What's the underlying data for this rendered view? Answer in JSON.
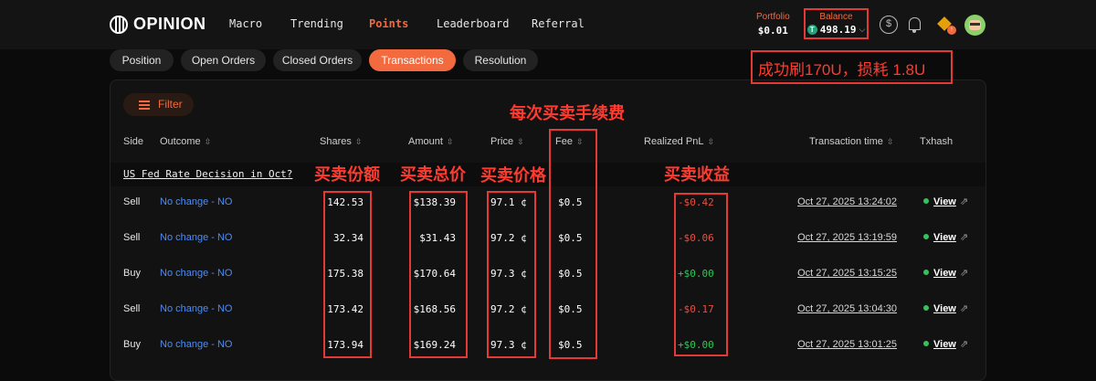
{
  "brand": "OPINION",
  "nav": [
    "Macro",
    "Trending",
    "Points",
    "Leaderboard",
    "Referral"
  ],
  "nav_active": "Points",
  "portfolio": {
    "label": "Portfolio",
    "value": "$0.01"
  },
  "balance": {
    "label": "Balance",
    "coin": "T",
    "value": "498.19"
  },
  "icons": {
    "dollar": "dollar-circle-icon",
    "bell": "bell-icon",
    "cube": "cube-icon",
    "cube_badge": "↑"
  },
  "tabs": [
    "Position",
    "Open Orders",
    "Closed Orders",
    "Transactions",
    "Resolution"
  ],
  "active_tab": "Transactions",
  "filter_label": "Filter",
  "columns": [
    "Side",
    "Outcome",
    "Shares",
    "Amount",
    "Price",
    "Fee",
    "Realized PnL",
    "Transaction time",
    "Txhash"
  ],
  "group_title": "US Fed Rate Decision in Oct?",
  "rows": [
    {
      "side": "Sell",
      "outcome": "No change - NO",
      "shares": "142.53",
      "amount": "$138.39",
      "price": "97.1 ¢",
      "fee": "$0.5",
      "pnl": "-$0.42",
      "time": "Oct 27, 2025 13:24:02",
      "tx": "View"
    },
    {
      "side": "Sell",
      "outcome": "No change - NO",
      "shares": "32.34",
      "amount": "$31.43",
      "price": "97.2 ¢",
      "fee": "$0.5",
      "pnl": "-$0.06",
      "time": "Oct 27, 2025 13:19:59",
      "tx": "View"
    },
    {
      "side": "Buy",
      "outcome": "No change - NO",
      "shares": "175.38",
      "amount": "$170.64",
      "price": "97.3 ¢",
      "fee": "$0.5",
      "pnl": "+$0.00",
      "time": "Oct 27, 2025 13:15:25",
      "tx": "View"
    },
    {
      "side": "Sell",
      "outcome": "No change - NO",
      "shares": "173.42",
      "amount": "$168.56",
      "price": "97.2 ¢",
      "fee": "$0.5",
      "pnl": "-$0.17",
      "time": "Oct 27, 2025 13:04:30",
      "tx": "View"
    },
    {
      "side": "Buy",
      "outcome": "No change - NO",
      "shares": "173.94",
      "amount": "$169.24",
      "price": "97.3 ¢",
      "fee": "$0.5",
      "pnl": "+$0.00",
      "time": "Oct 27, 2025 13:01:25",
      "tx": "View"
    }
  ],
  "annotations": {
    "note": "成功刷170U，损耗 1.8U",
    "fee": "每次买卖手续费",
    "shares": "买卖份额",
    "amount": "买卖总价",
    "price": "买卖价格",
    "pnl": "买卖收益"
  },
  "colors": {
    "accent": "#f26a3d",
    "annotation": "#e53935",
    "negative": "#e15146",
    "positive": "#35c25a",
    "link": "#4e8cf5"
  }
}
